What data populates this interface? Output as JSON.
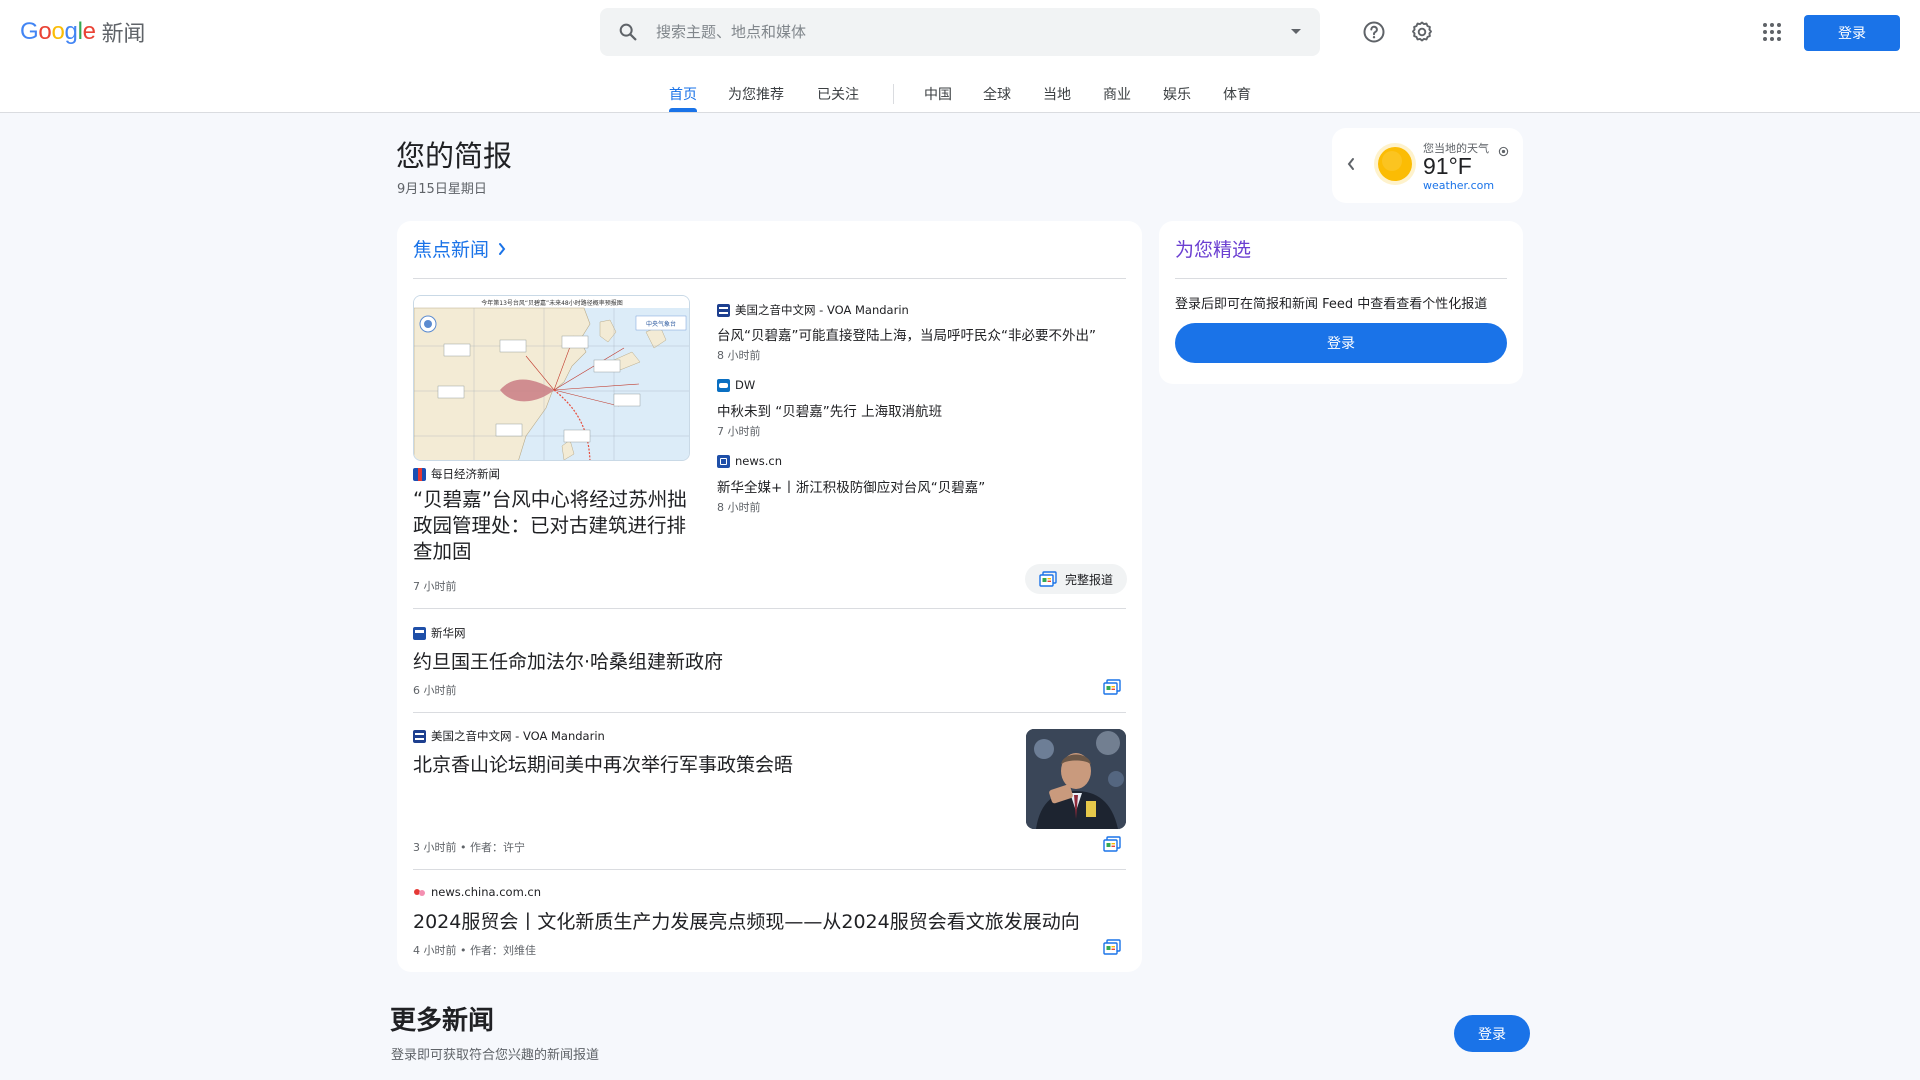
{
  "header": {
    "logo_google": "Google",
    "logo_suffix": "新闻",
    "search_placeholder": "搜索主题、地点和媒体",
    "signin_label": "登录"
  },
  "tabs": [
    {
      "label": "首页",
      "active": true
    },
    {
      "label": "为您推荐"
    },
    {
      "label": "已关注"
    },
    {
      "label": "中国"
    },
    {
      "label": "全球"
    },
    {
      "label": "当地"
    },
    {
      "label": "商业"
    },
    {
      "label": "娱乐"
    },
    {
      "label": "体育"
    }
  ],
  "briefing": {
    "title": "您的简报",
    "date": "9月15日星期日"
  },
  "weather": {
    "label": "您当地的天气",
    "temperature": "91°F",
    "source": "weather.com"
  },
  "top_stories": {
    "title": "焦点新闻",
    "lead": {
      "source": "每日经济新闻",
      "headline": "“贝碧嘉”台风中心将经过苏州拙政园管理处：已对古建筑进行排查加固",
      "time": "7 小时前",
      "map_caption": "今年第13号台风“贝碧嘉”未来48小时路径概率预报图",
      "map_brand": "中央气象台"
    },
    "related": [
      {
        "source": "美国之音中文网 - VOA Mandarin",
        "headline": "台风“贝碧嘉”可能直接登陆上海，当局呼吁民众“非必要不外出”",
        "time": "8 小时前"
      },
      {
        "source": "DW",
        "headline": "中秋未到 “贝碧嘉”先行 上海取消航班",
        "time": "7 小时前"
      },
      {
        "source": "news.cn",
        "headline": "新华全媒+丨浙江积极防御应对台风“贝碧嘉”",
        "time": "8 小时前"
      }
    ],
    "full_coverage": "完整报道",
    "stories": [
      {
        "source": "新华网",
        "headline": "约旦国王任命加法尔·哈桑组建新政府",
        "time": "6 小时前"
      },
      {
        "source": "美国之音中文网 - VOA Mandarin",
        "headline": "北京香山论坛期间美中再次举行军事政策会晤",
        "time": "3 小时前 • 作者：许宁"
      },
      {
        "source": "news.china.com.cn",
        "headline": "2024服贸会丨文化新质生产力发展亮点频现——从2024服贸会看文旅发展动向",
        "time": "4 小时前 • 作者：刘维佳"
      }
    ]
  },
  "picks": {
    "title": "为您精选",
    "description": "登录后即可在简报和新闻 Feed 中查看查看个性化报道",
    "button": "登录"
  },
  "more_news": {
    "title": "更多新闻",
    "description": "登录即可获取符合您兴趣的新闻报道",
    "button": "登录"
  },
  "colors": {
    "accent": "#1a73e8",
    "picks_title": "#6b3fd1",
    "page_bg": "#f6f8fc"
  }
}
